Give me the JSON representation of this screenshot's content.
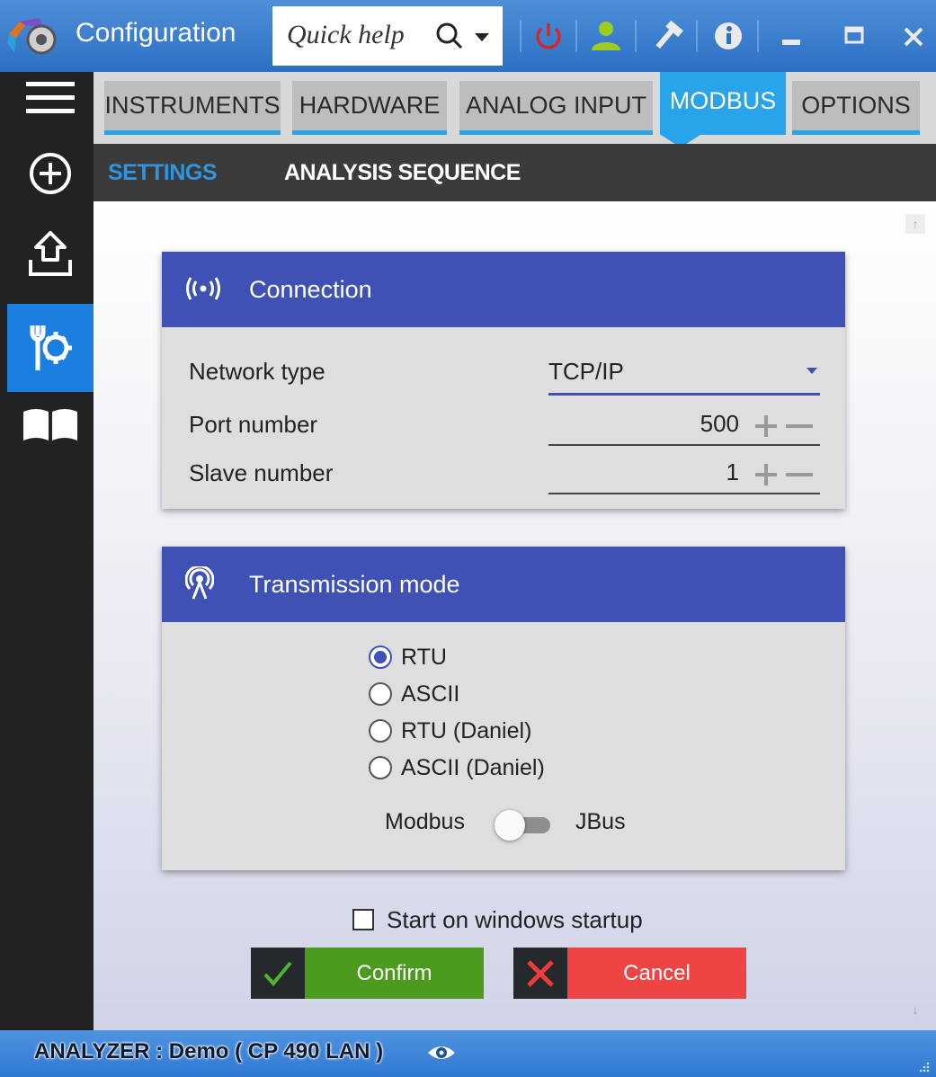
{
  "window": {
    "title": "Configuration",
    "quick_help_placeholder": "Quick help",
    "toolbar_icons": [
      "power-icon",
      "user-icon",
      "tools-icon",
      "info-icon",
      "minimize-icon",
      "maximize-icon",
      "close-icon"
    ]
  },
  "sidebar": {
    "items": [
      {
        "icon": "menu-icon"
      },
      {
        "icon": "add-icon"
      },
      {
        "icon": "upload-icon"
      },
      {
        "icon": "settings-tools-icon",
        "active": true
      },
      {
        "icon": "book-icon"
      }
    ]
  },
  "tabs": [
    {
      "label": "INSTRUMENTS"
    },
    {
      "label": "HARDWARE"
    },
    {
      "label": "ANALOG INPUT"
    },
    {
      "label": "MODBUS",
      "active": true
    },
    {
      "label": "OPTIONS"
    }
  ],
  "subtabs": [
    {
      "label": "SETTINGS",
      "active": true
    },
    {
      "label": "ANALYSIS SEQUENCE"
    }
  ],
  "connection": {
    "title": "Connection",
    "icon": "broadcast-icon",
    "network_type_label": "Network  type",
    "network_type_value": "TCP/IP",
    "port_label": "Port number",
    "port_value": "500",
    "slave_label": "Slave number",
    "slave_value": "1"
  },
  "transmission": {
    "title": "Transmission mode",
    "icon": "antenna-icon",
    "options": [
      {
        "label": "RTU",
        "checked": true
      },
      {
        "label": "ASCII",
        "checked": false
      },
      {
        "label": "RTU (Daniel)",
        "checked": false
      },
      {
        "label": "ASCII (Daniel)",
        "checked": false
      }
    ],
    "toggle_left": "Modbus",
    "toggle_right": "JBus",
    "toggle_on": false
  },
  "startup": {
    "label": "Start on windows startup",
    "checked": false
  },
  "buttons": {
    "confirm": "Confirm",
    "cancel": "Cancel"
  },
  "colors": {
    "accent": "#29a3ea",
    "card_header": "#3f51b5",
    "confirm": "#4c9a1e",
    "cancel": "#ef4444",
    "sidebar": "#222222"
  },
  "status": {
    "text": "ANALYZER :  Demo ( CP 490 LAN )"
  }
}
